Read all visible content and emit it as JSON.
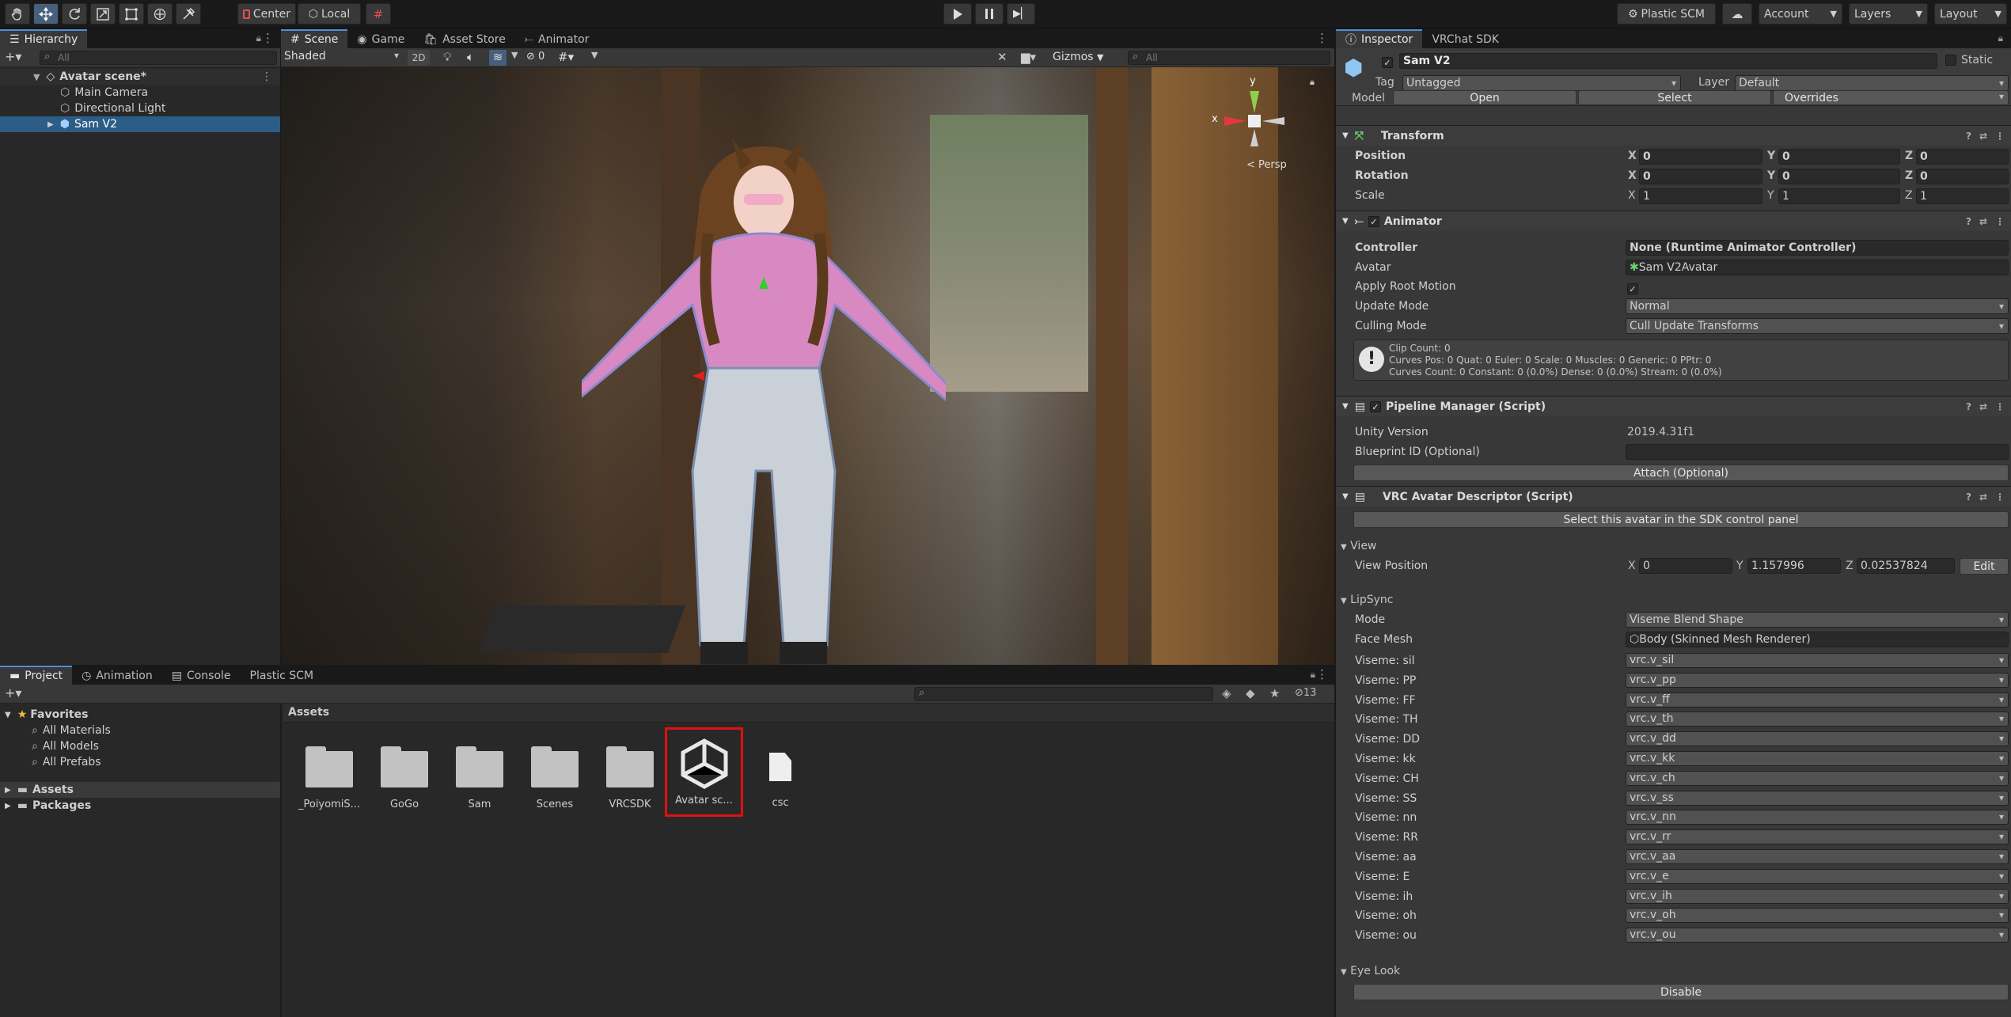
{
  "toolbar": {
    "center_label": "Center",
    "local_label": "Local",
    "plastic_label": "Plastic SCM",
    "account_label": "Account",
    "layers_label": "Layers",
    "layout_label": "Layout"
  },
  "hierarchy": {
    "tab": "Hierarchy",
    "search_placeholder": "All",
    "scene": "Avatar scene*",
    "items": [
      "Main Camera",
      "Directional Light",
      "Sam V2"
    ]
  },
  "scene_view": {
    "tabs": [
      "Scene",
      "Game",
      "Asset Store",
      "Animator"
    ],
    "shading": "Shaded",
    "mode_2d": "2D",
    "hidden_count": "0",
    "gizmos": "Gizmos",
    "search_placeholder": "All",
    "persp": "Persp",
    "axis_y": "y",
    "axis_x": "x"
  },
  "project": {
    "tabs": [
      "Project",
      "Animation",
      "Console",
      "Plastic SCM"
    ],
    "favorites": "Favorites",
    "fav_items": [
      "All Materials",
      "All Models",
      "All Prefabs"
    ],
    "roots": [
      "Assets",
      "Packages"
    ],
    "breadcrumb": "Assets",
    "count": "13",
    "assets": [
      "_PoiyomiS...",
      "GoGo",
      "Sam",
      "Scenes",
      "VRCSDK",
      "Avatar sc...",
      "csc"
    ]
  },
  "inspector": {
    "tabs": [
      "Inspector",
      "VRChat SDK"
    ],
    "object_name": "Sam V2",
    "static_label": "Static",
    "tag_label": "Tag",
    "tag_value": "Untagged",
    "layer_label": "Layer",
    "layer_value": "Default",
    "model_label": "Model",
    "open_btn": "Open",
    "select_btn": "Select",
    "overrides": "Overrides",
    "transform": {
      "title": "Transform",
      "position": "Position",
      "rotation": "Rotation",
      "scale": "Scale",
      "pos": [
        "0",
        "0",
        "0"
      ],
      "rot": [
        "0",
        "0",
        "0"
      ],
      "scl": [
        "1",
        "1",
        "1"
      ],
      "axes": [
        "X",
        "Y",
        "Z"
      ]
    },
    "animator": {
      "title": "Animator",
      "controller_label": "Controller",
      "controller_value": "None (Runtime Animator Controller)",
      "avatar_label": "Avatar",
      "avatar_value": "Sam V2Avatar",
      "root_motion_label": "Apply Root Motion",
      "update_label": "Update Mode",
      "update_value": "Normal",
      "culling_label": "Culling Mode",
      "culling_value": "Cull Update Transforms",
      "info1": "Clip Count: 0",
      "info2": "Curves Pos: 0 Quat: 0 Euler: 0 Scale: 0 Muscles: 0 Generic: 0 PPtr: 0",
      "info3": "Curves Count: 0 Constant: 0 (0.0%) Dense: 0 (0.0%) Stream: 0 (0.0%)"
    },
    "pipeline": {
      "title": "Pipeline Manager (Script)",
      "unity_label": "Unity Version",
      "unity_value": "2019.4.31f1",
      "blueprint_label": "Blueprint ID (Optional)",
      "attach_btn": "Attach (Optional)"
    },
    "descriptor": {
      "title": "VRC Avatar Descriptor (Script)",
      "select_btn": "Select this avatar in the SDK control panel",
      "view_label": "View",
      "view_pos_label": "View Position",
      "view_x": "0",
      "view_y": "1.157996",
      "view_z": "0.02537824",
      "edit_btn": "Edit",
      "lipsync_label": "LipSync",
      "mode_label": "Mode",
      "mode_value": "Viseme Blend Shape",
      "face_label": "Face Mesh",
      "face_value": "Body (Skinned Mesh Renderer)",
      "visemes": [
        {
          "label": "Viseme: sil",
          "value": "vrc.v_sil"
        },
        {
          "label": "Viseme: PP",
          "value": "vrc.v_pp"
        },
        {
          "label": "Viseme: FF",
          "value": "vrc.v_ff"
        },
        {
          "label": "Viseme: TH",
          "value": "vrc.v_th"
        },
        {
          "label": "Viseme: DD",
          "value": "vrc.v_dd"
        },
        {
          "label": "Viseme: kk",
          "value": "vrc.v_kk"
        },
        {
          "label": "Viseme: CH",
          "value": "vrc.v_ch"
        },
        {
          "label": "Viseme: SS",
          "value": "vrc.v_ss"
        },
        {
          "label": "Viseme: nn",
          "value": "vrc.v_nn"
        },
        {
          "label": "Viseme: RR",
          "value": "vrc.v_rr"
        },
        {
          "label": "Viseme: aa",
          "value": "vrc.v_aa"
        },
        {
          "label": "Viseme: E",
          "value": "vrc.v_e"
        },
        {
          "label": "Viseme: ih",
          "value": "vrc.v_ih"
        },
        {
          "label": "Viseme: oh",
          "value": "vrc.v_oh"
        },
        {
          "label": "Viseme: ou",
          "value": "vrc.v_ou"
        }
      ],
      "eye_label": "Eye Look",
      "disable_btn": "Disable"
    }
  }
}
